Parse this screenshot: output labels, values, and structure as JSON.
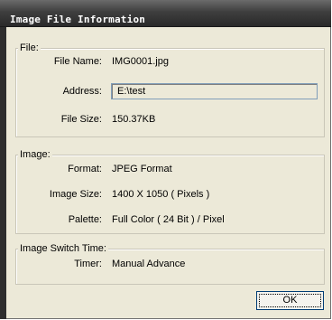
{
  "window": {
    "title": "Image File Information"
  },
  "file_group": {
    "legend": "File:",
    "name_label": "File Name:",
    "name_value": "IMG0001.jpg",
    "address_label": "Address:",
    "address_value": "E:\\test",
    "size_label": "File Size:",
    "size_value": "150.37KB"
  },
  "image_group": {
    "legend": "Image:",
    "format_label": "Format:",
    "format_value": "JPEG Format",
    "size_label": "Image Size:",
    "size_value": "1400 X 1050 ( Pixels )",
    "palette_label": "Palette:",
    "palette_value": "Full Color ( 24 Bit ) / Pixel"
  },
  "switch_group": {
    "legend": "Image Switch Time:",
    "timer_label": "Timer:",
    "timer_value": "Manual Advance"
  },
  "buttons": {
    "ok_label": "OK"
  }
}
